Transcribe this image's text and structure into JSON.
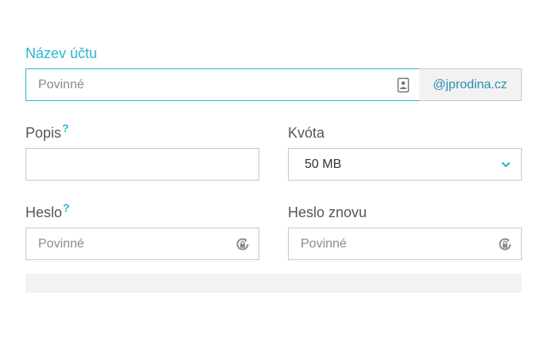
{
  "account_name": {
    "label": "Název účtu",
    "placeholder": "Povinné",
    "domain_suffix": "@jprodina.cz",
    "icon": "contact-card-icon"
  },
  "description": {
    "label": "Popis",
    "help": "?",
    "value": ""
  },
  "quota": {
    "label": "Kvóta",
    "selected": "50 MB",
    "icon": "chevron-down-icon"
  },
  "password": {
    "label": "Heslo",
    "help": "?",
    "placeholder": "Povinné",
    "icon": "password-generator-icon"
  },
  "password_repeat": {
    "label": "Heslo znovu",
    "placeholder": "Povinné",
    "icon": "password-generator-icon"
  },
  "colors": {
    "accent": "#29b6d2",
    "suffix_text": "#2a8fb0",
    "border": "#c6c6c6",
    "muted_bg": "#f2f2f2"
  }
}
